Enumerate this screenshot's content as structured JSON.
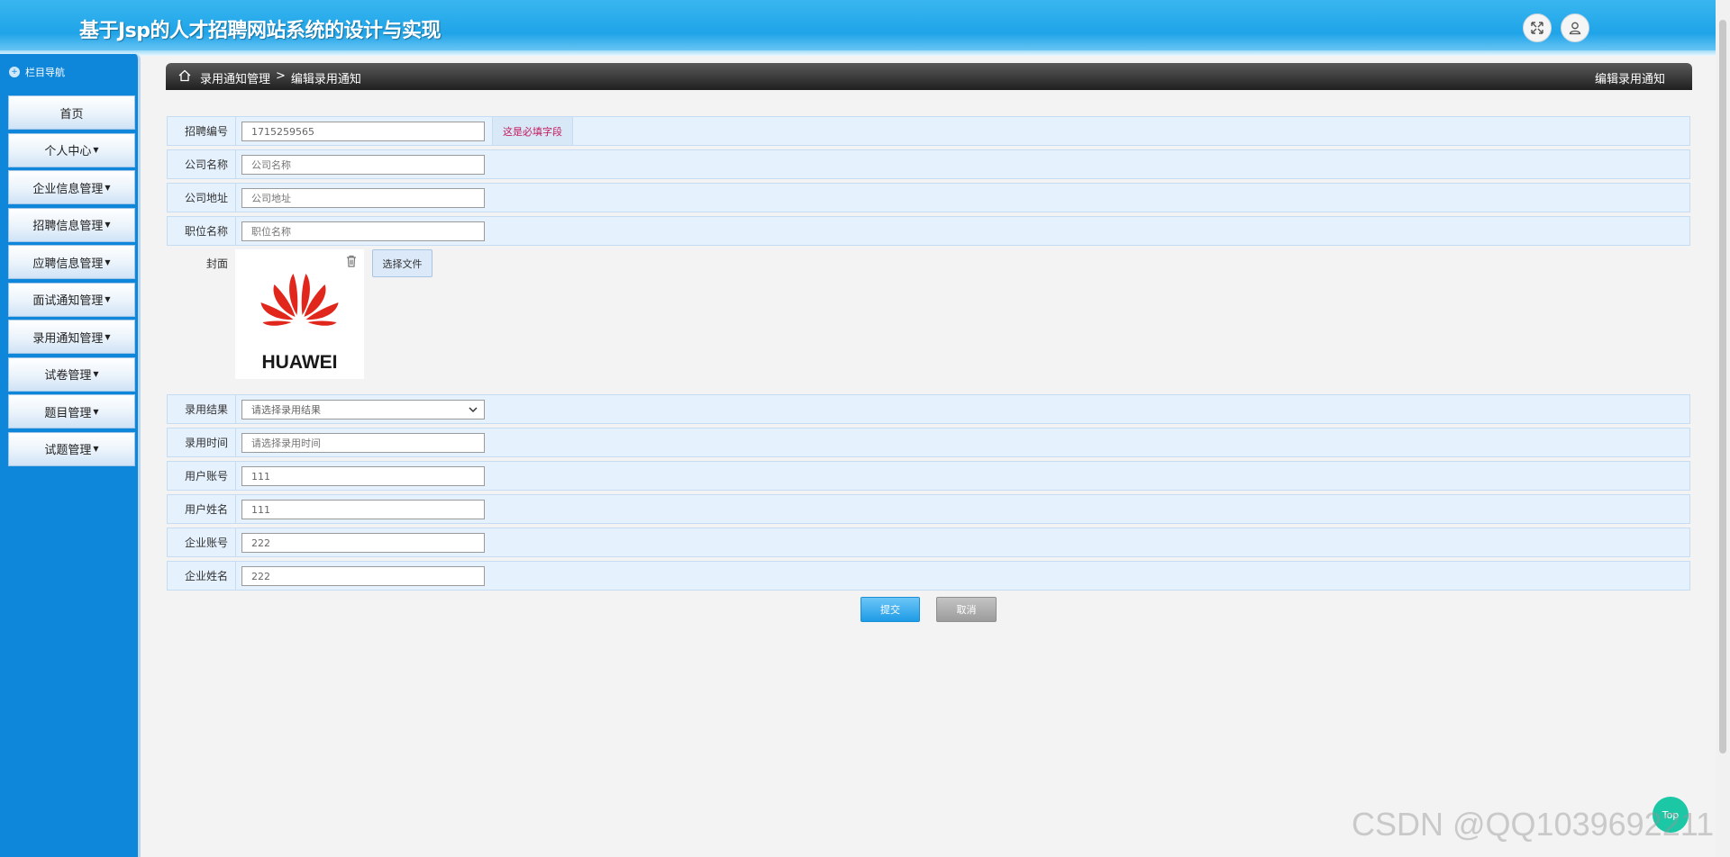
{
  "header": {
    "title": "基于Jsp的人才招聘网站系统的设计与实现",
    "icons": [
      "fullscreen-icon",
      "user-icon"
    ]
  },
  "sidebar": {
    "heading": "栏目导航",
    "items": [
      {
        "label": "首页",
        "has_caret": false
      },
      {
        "label": "个人中心",
        "has_caret": true
      },
      {
        "label": "企业信息管理",
        "has_caret": true
      },
      {
        "label": "招聘信息管理",
        "has_caret": true
      },
      {
        "label": "应聘信息管理",
        "has_caret": true
      },
      {
        "label": "面试通知管理",
        "has_caret": true
      },
      {
        "label": "录用通知管理",
        "has_caret": true
      },
      {
        "label": "试卷管理",
        "has_caret": true
      },
      {
        "label": "题目管理",
        "has_caret": true
      },
      {
        "label": "试题管理",
        "has_caret": true
      }
    ]
  },
  "breadcrumb": {
    "parent": "录用通知管理",
    "separator": ">",
    "current": "编辑录用通知",
    "page_title": "编辑录用通知"
  },
  "form": {
    "recruit_no": {
      "label": "招聘编号",
      "value": "1715259565",
      "required_hint": "这是必填字段"
    },
    "company_name": {
      "label": "公司名称",
      "placeholder": "公司名称"
    },
    "company_addr": {
      "label": "公司地址",
      "placeholder": "公司地址"
    },
    "position": {
      "label": "职位名称",
      "placeholder": "职位名称"
    },
    "cover": {
      "label": "封面",
      "file_button": "选择文件",
      "image_text": "HUAWEI"
    },
    "result": {
      "label": "录用结果",
      "selected": "请选择录用结果"
    },
    "hire_time": {
      "label": "录用时间",
      "placeholder": "请选择录用时间"
    },
    "user_account": {
      "label": "用户账号",
      "value": "111"
    },
    "user_name": {
      "label": "用户姓名",
      "value": "111"
    },
    "company_account": {
      "label": "企业账号",
      "value": "222"
    },
    "company_contact": {
      "label": "企业姓名",
      "value": "222"
    },
    "submit": "提交",
    "cancel": "取消"
  },
  "floating_button": "Top",
  "watermark": "CSDN @QQ1039692211",
  "colors": {
    "header_blue": "#1fa4e8",
    "sidebar_blue": "#0e86d9",
    "required_text": "#c2185b",
    "huawei_red": "#e1261c"
  }
}
